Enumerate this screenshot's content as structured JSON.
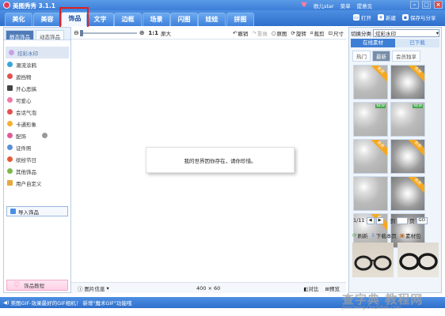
{
  "titlebar": {
    "app_title": "美图秀秀 3.1.1",
    "user_name": "欧儿star",
    "menu_label": "菜单",
    "feedback_label": "提意见"
  },
  "tabs": [
    {
      "label": "美化",
      "active": false
    },
    {
      "label": "美容",
      "active": false
    },
    {
      "label": "饰品",
      "active": true
    },
    {
      "label": "文字",
      "active": false
    },
    {
      "label": "边框",
      "active": false
    },
    {
      "label": "场景",
      "active": false
    },
    {
      "label": "闪图",
      "active": false
    },
    {
      "label": "娃娃",
      "active": false
    },
    {
      "label": "拼图",
      "active": false
    }
  ],
  "top_actions": {
    "open": "打开",
    "new": "新建",
    "save_share": "保存与分享"
  },
  "left_panel": {
    "tabs": [
      "静态饰品",
      "动态饰品"
    ],
    "items": [
      "炫彩水印",
      "潮流涂鸦",
      "遮挡物",
      "开心恶搞",
      "可爱心",
      "会话气泡",
      "卡通形象",
      "配饰",
      "证件照",
      "缤纷节日",
      "其他饰品",
      "用户自定义"
    ],
    "active_index": 0,
    "import_label": "导入饰品",
    "help_label": "饰品教程"
  },
  "canvas_toolbar": {
    "ratio": "1:1",
    "original_size": "原大",
    "undo": "撤销",
    "redo": "重做",
    "original": "原图",
    "rotate": "旋转",
    "crop": "裁剪",
    "resize": "尺寸"
  },
  "canvas": {
    "placeholder_text": "我的世界因你存在，请你珍惜。"
  },
  "status_bar": {
    "info_label": "图片信息",
    "size": "400 × 60",
    "compare": "对比",
    "preview": "预览"
  },
  "right_panel": {
    "switch_label": "切换分类",
    "category": "炫彩水印",
    "main_tabs": [
      "在线素材",
      "已下载"
    ],
    "sub_tabs": [
      "热门",
      "最新",
      "会员独享"
    ],
    "active_sub_tab": 1,
    "cells": [
      {
        "ribbon": "会员",
        "badge": ""
      },
      {
        "ribbon": "会员",
        "badge": ""
      },
      {
        "ribbon": "",
        "badge": "NEW"
      },
      {
        "ribbon": "",
        "badge": "NEW"
      },
      {
        "ribbon": "会员",
        "badge": ""
      },
      {
        "ribbon": "会员",
        "badge": ""
      },
      {
        "ribbon": "",
        "badge": ""
      },
      {
        "ribbon": "会员",
        "badge": ""
      },
      {
        "ribbon": "会员",
        "badge": ""
      },
      {
        "ribbon": "",
        "badge": ""
      }
    ],
    "page_info": "1/11",
    "page_unit": "页",
    "go_label": "GO",
    "refresh": "刷新",
    "download_page": "下载本页",
    "material_pack": "素材包"
  },
  "footer": {
    "message": "美图GIF-效果最好的GIF相机！ 新增\"魔术GIF\"功能哦"
  },
  "watermark": {
    "text": "查字典 教程网",
    "url": "jiaocheng.chazidian.com"
  },
  "colors": {
    "title_blue": "#3d7fd8",
    "highlight_red": "#e02020",
    "ribbon_orange": "#f4a820",
    "active_tab_bg": "#f4f8fe"
  }
}
